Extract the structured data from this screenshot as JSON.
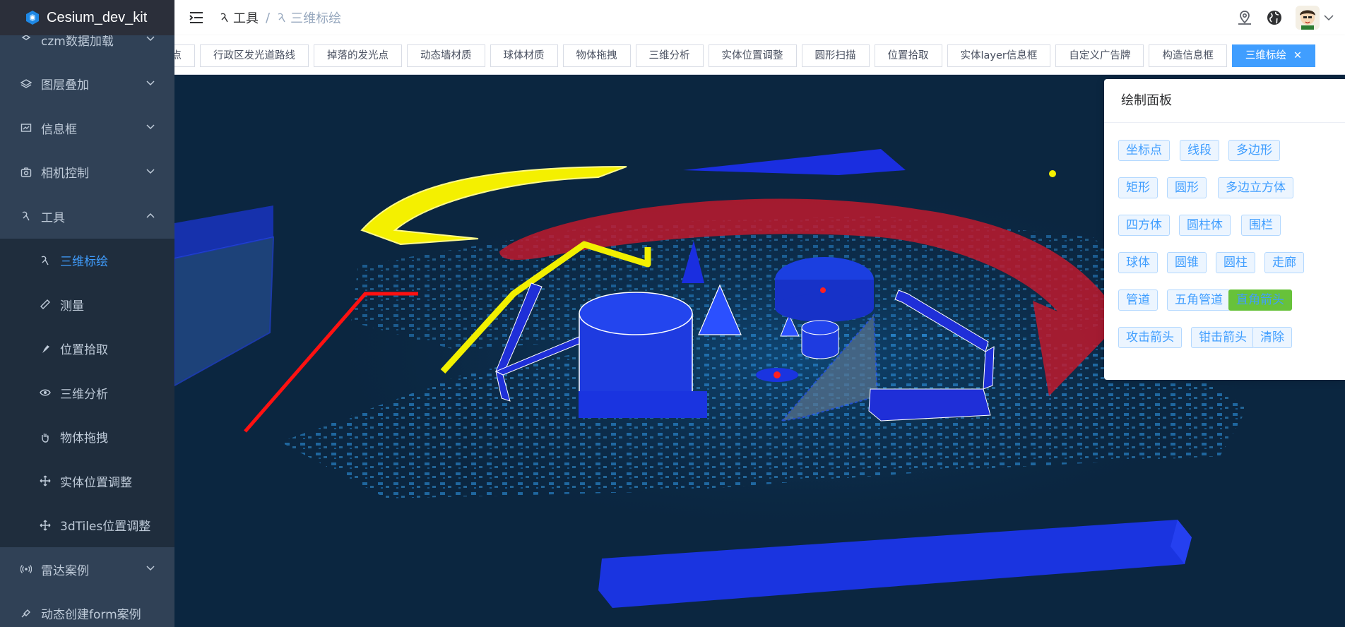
{
  "app": {
    "title": "Cesium_dev_kit"
  },
  "sidebar": {
    "items": [
      {
        "label": "czm数据加载",
        "icon": "load-icon",
        "expanded": false
      },
      {
        "label": "图层叠加",
        "icon": "layers-icon",
        "expanded": false
      },
      {
        "label": "信息框",
        "icon": "info-box-icon",
        "expanded": false
      },
      {
        "label": "相机控制",
        "icon": "camera-icon",
        "expanded": false
      },
      {
        "label": "工具",
        "icon": "tool-icon",
        "expanded": true
      },
      {
        "label": "三维标绘",
        "icon": "tool-icon",
        "sub": true,
        "active": true
      },
      {
        "label": "测量",
        "icon": "ruler-icon",
        "sub": true
      },
      {
        "label": "位置拾取",
        "icon": "pick-icon",
        "sub": true
      },
      {
        "label": "三维分析",
        "icon": "eye-icon",
        "sub": true
      },
      {
        "label": "物体拖拽",
        "icon": "hand-icon",
        "sub": true
      },
      {
        "label": "实体位置调整",
        "icon": "move-icon",
        "sub": true
      },
      {
        "label": "3dTiles位置调整",
        "icon": "move-icon",
        "sub": true
      },
      {
        "label": "雷达案例",
        "icon": "radar-icon",
        "expanded": false
      },
      {
        "label": "动态创建form案例",
        "icon": "form-icon",
        "expanded": false
      }
    ]
  },
  "breadcrumb": {
    "items": [
      "工具",
      "三维标绘"
    ]
  },
  "tags": [
    "光点",
    "行政区发光道路线",
    "掉落的发光点",
    "动态墙材质",
    "球体材质",
    "物体拖拽",
    "三维分析",
    "实体位置调整",
    "圆形扫描",
    "位置拾取",
    "实体layer信息框",
    "自定义广告牌",
    "构造信息框",
    "三维标绘"
  ],
  "active_tag": "三维标绘",
  "panel": {
    "title": "绘制面板",
    "buttons": [
      "坐标点",
      "线段",
      "多边形",
      "矩形",
      "圆形",
      "多边立方体",
      "四方体",
      "圆柱体",
      "围栏",
      "球体",
      "圆锥",
      "圆柱",
      "走廊",
      "管道",
      "五角管道",
      "直角箭头",
      "攻击箭头",
      "钳击箭头",
      "清除"
    ],
    "highlighted": "直角箭头"
  },
  "colors": {
    "sidebar_bg": "#304156",
    "accent": "#409eff",
    "highlight": "#67c23a",
    "scene_bg": "#0b2640"
  }
}
